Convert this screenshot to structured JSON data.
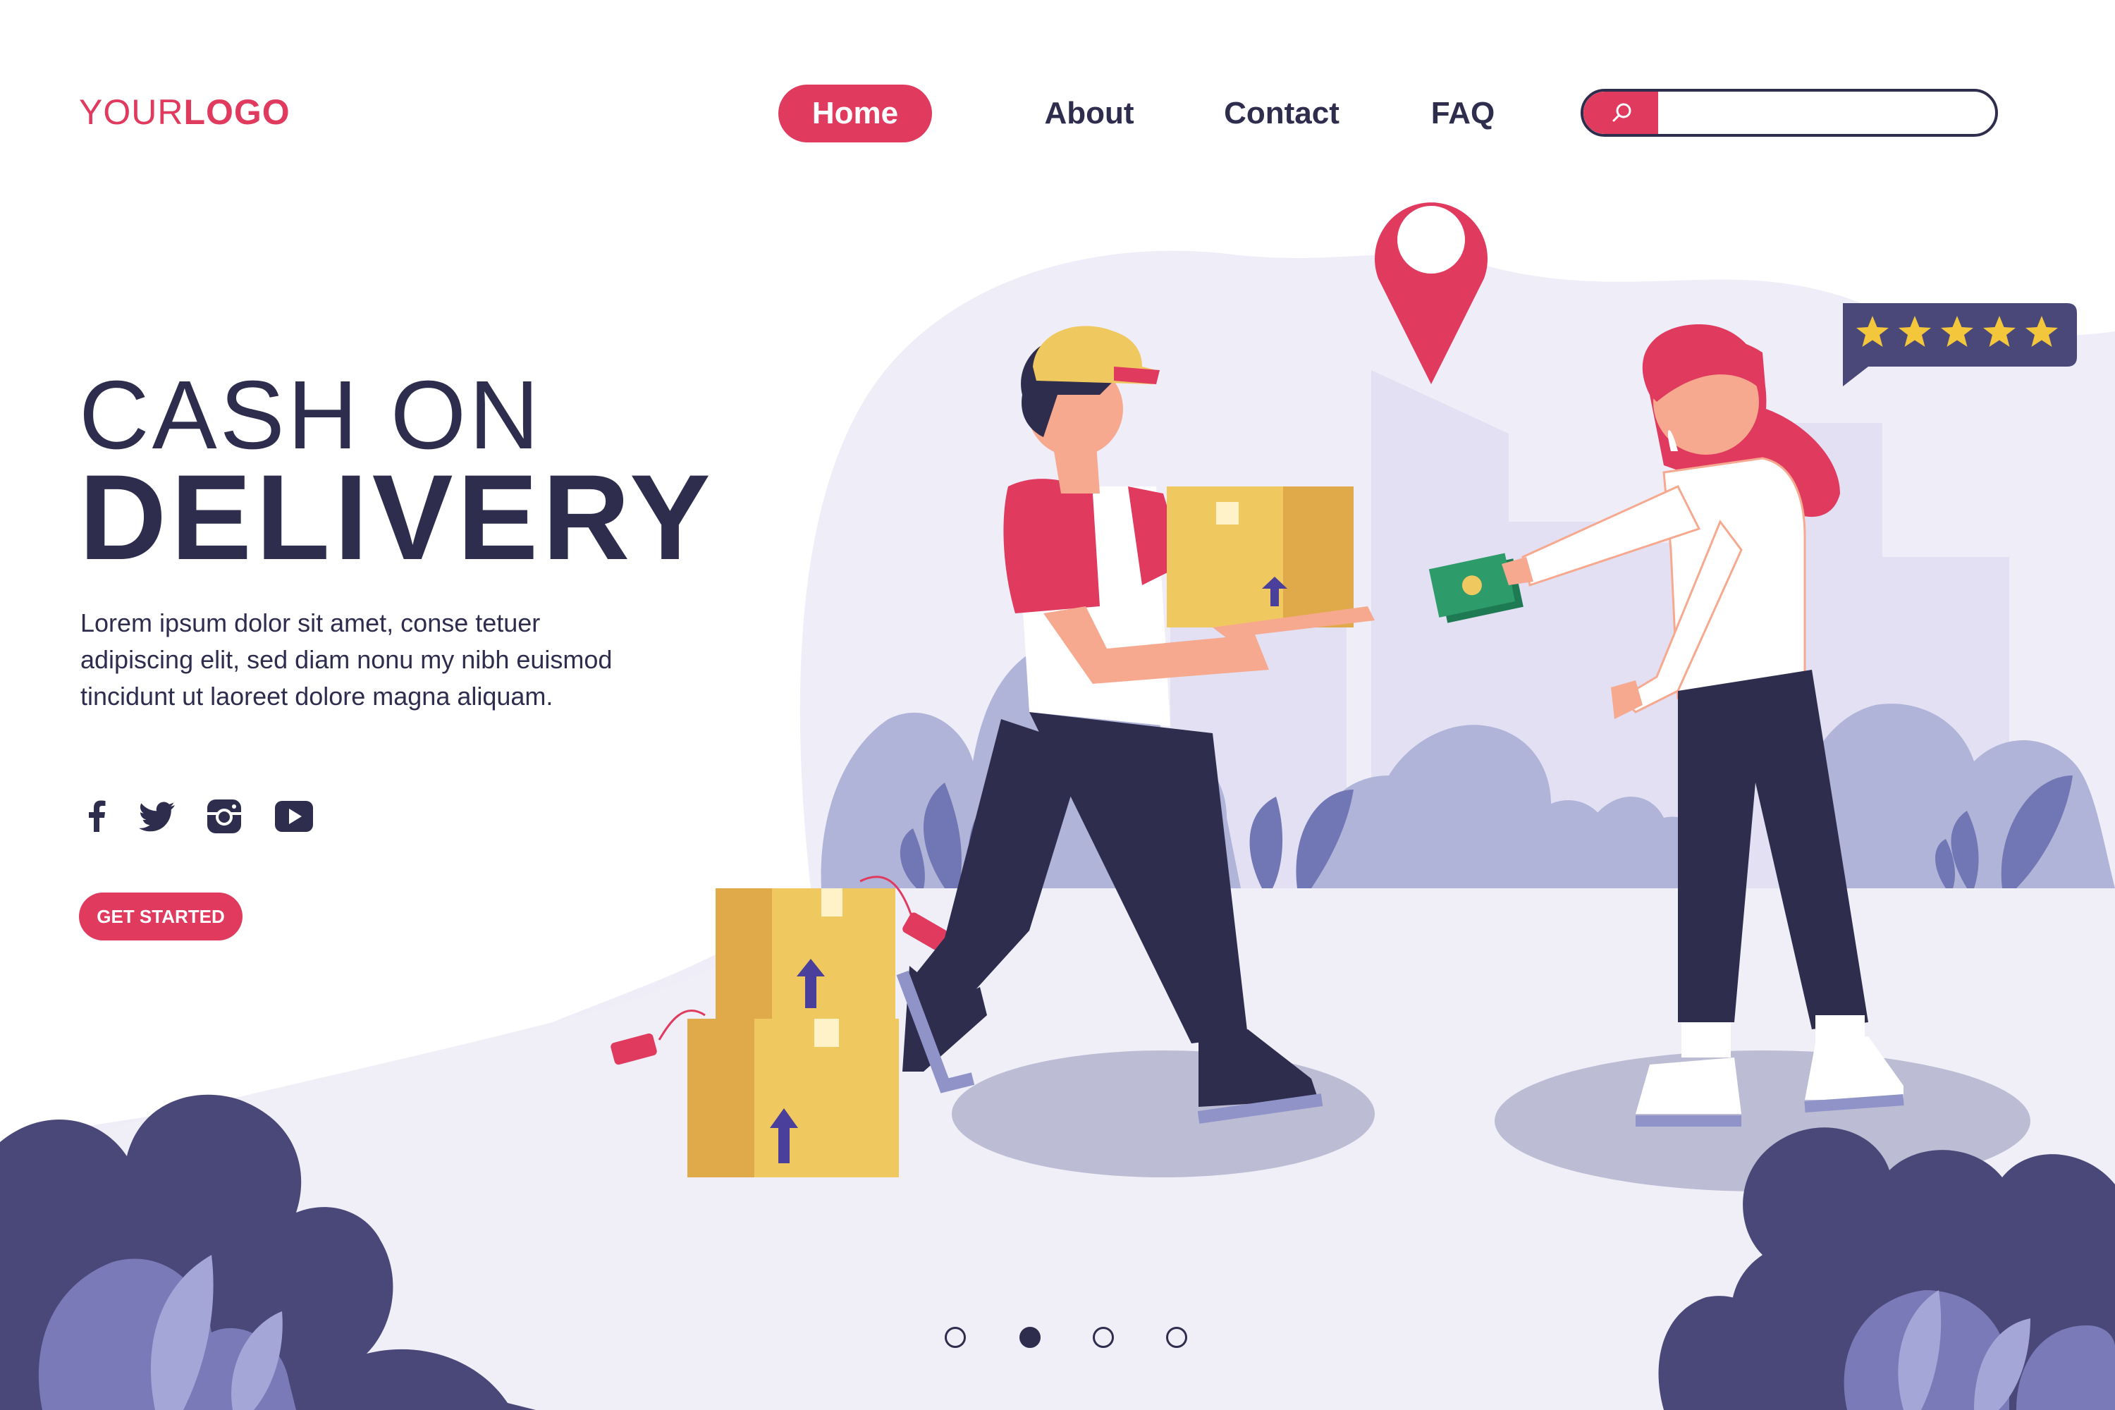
{
  "logo": {
    "part1": "YOUR",
    "part2": "LOGO"
  },
  "nav": {
    "home": "Home",
    "about": "About",
    "contact": "Contact",
    "faq": "FAQ"
  },
  "search": {
    "placeholder": "",
    "value": ""
  },
  "hero": {
    "title_line1": "CASH ON",
    "title_line2": "DELIVERY",
    "description": "Lorem ipsum dolor sit amet, conse tetuer adipiscing elit, sed diam nonu my nibh euismod tincidunt ut laoreet dolore magna aliquam.",
    "cta": "GET STARTED"
  },
  "social": [
    "facebook-icon",
    "twitter-icon",
    "instagram-icon",
    "youtube-icon"
  ],
  "rating": {
    "stars": 5,
    "max": 5
  },
  "pagination": {
    "total": 4,
    "active": 2
  },
  "colors": {
    "accent": "#e03a5f",
    "dark": "#2f2d4e",
    "lavender": "#e9e7f6",
    "plant": "#4a4878",
    "box": "#f0c860"
  }
}
